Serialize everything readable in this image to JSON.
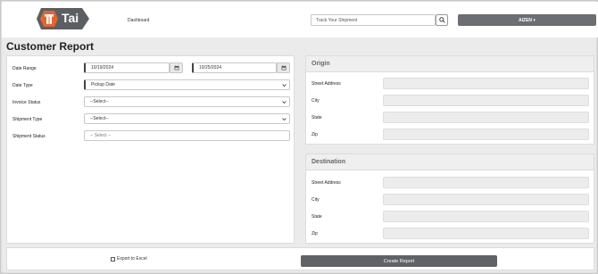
{
  "brand": {
    "logo_text": "Tai"
  },
  "nav": {
    "dashboard": "Dashboard"
  },
  "search": {
    "placeholder": "Track Your Shipment"
  },
  "user": {
    "label": "AIZEN ▾"
  },
  "page": {
    "title": "Customer Report"
  },
  "filters": {
    "date_range_label": "Date Range",
    "date_from": "10/19/2024",
    "date_to": "10/25/2024",
    "date_type_label": "Date Type",
    "date_type_value": "Pickup Date",
    "invoice_status_label": "Invoice Status",
    "invoice_status_value": "--Select--",
    "shipment_type_label": "Shipment Type",
    "shipment_type_value": "--Select--",
    "shipment_status_label": "Shipment Status",
    "shipment_status_placeholder": "-- Select --"
  },
  "origin": {
    "title": "Origin",
    "street_label": "Street Address",
    "city_label": "City",
    "state_label": "State",
    "zip_label": "Zip"
  },
  "destination": {
    "title": "Destination",
    "street_label": "Street Address",
    "city_label": "City",
    "state_label": "State",
    "zip_label": "Zip"
  },
  "footer": {
    "export_label": "Export to Excel",
    "create_label": "Create Report"
  },
  "colors": {
    "accent_orange": "#e8632b",
    "logo_gray": "#5b5e63",
    "button_gray": "#6b6e72"
  },
  "icons": {
    "search": "search-icon",
    "calendar": "calendar-icon",
    "chevron": "chevron-down-icon"
  }
}
